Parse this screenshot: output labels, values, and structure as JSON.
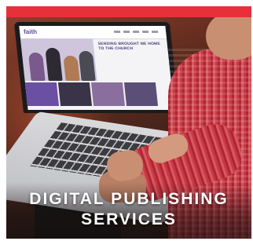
{
  "tile": {
    "title_line_1": "DIGITAL PUBLISHING",
    "title_line_2": "SERVICES"
  },
  "screen": {
    "logo": "faith",
    "headline": "SENDING BROUGHT ME HOME TO THE CHURCH"
  },
  "colors": {
    "accent_bar": "#e8303b",
    "caption_text": "#ffffff",
    "site_brand": "#5d4a9c"
  },
  "icons": [
    "laptop-image",
    "person-image"
  ]
}
